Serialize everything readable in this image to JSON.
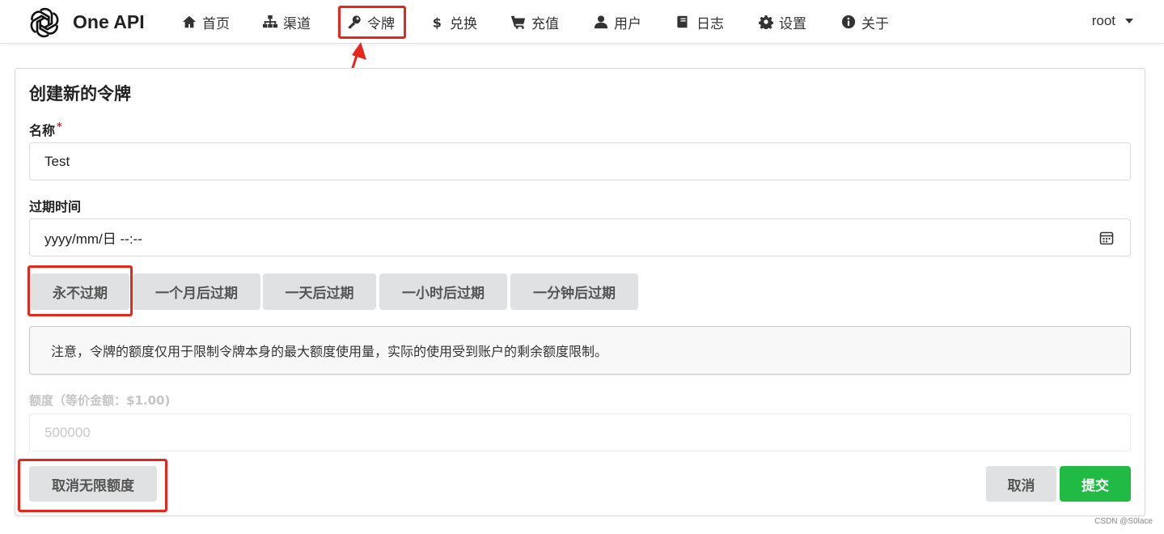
{
  "nav": {
    "brand": "One API",
    "items": [
      {
        "label": "首页",
        "icon": "home-icon"
      },
      {
        "label": "渠道",
        "icon": "sitemap-icon"
      },
      {
        "label": "令牌",
        "icon": "key-icon"
      },
      {
        "label": "兑换",
        "icon": "dollar-icon"
      },
      {
        "label": "充值",
        "icon": "cart-icon"
      },
      {
        "label": "用户",
        "icon": "user-icon"
      },
      {
        "label": "日志",
        "icon": "book-icon"
      },
      {
        "label": "设置",
        "icon": "gear-icon"
      },
      {
        "label": "关于",
        "icon": "info-icon"
      }
    ],
    "user": "root"
  },
  "form": {
    "title": "创建新的令牌",
    "name_label": "名称",
    "name_required": "*",
    "name_value": "Test",
    "expire_label": "过期时间",
    "expire_placeholder": "yyyy/mm/日 --:--",
    "expire_buttons": [
      "永不过期",
      "一个月后过期",
      "一天后过期",
      "一小时后过期",
      "一分钟后过期"
    ],
    "notice": "注意，令牌的额度仅用于限制令牌本身的最大额度使用量，实际的使用受到账户的剩余额度限制。",
    "quota_label": "额度（等价金额：$1.00)",
    "quota_value": "500000",
    "unlimited_button": "取消无限额度",
    "cancel_button": "取消",
    "submit_button": "提交"
  },
  "colors": {
    "annotation": "#e8271c",
    "submit": "#21ba45",
    "button_gray": "#e0e1e2"
  },
  "watermark": "CSDN @S0lace"
}
